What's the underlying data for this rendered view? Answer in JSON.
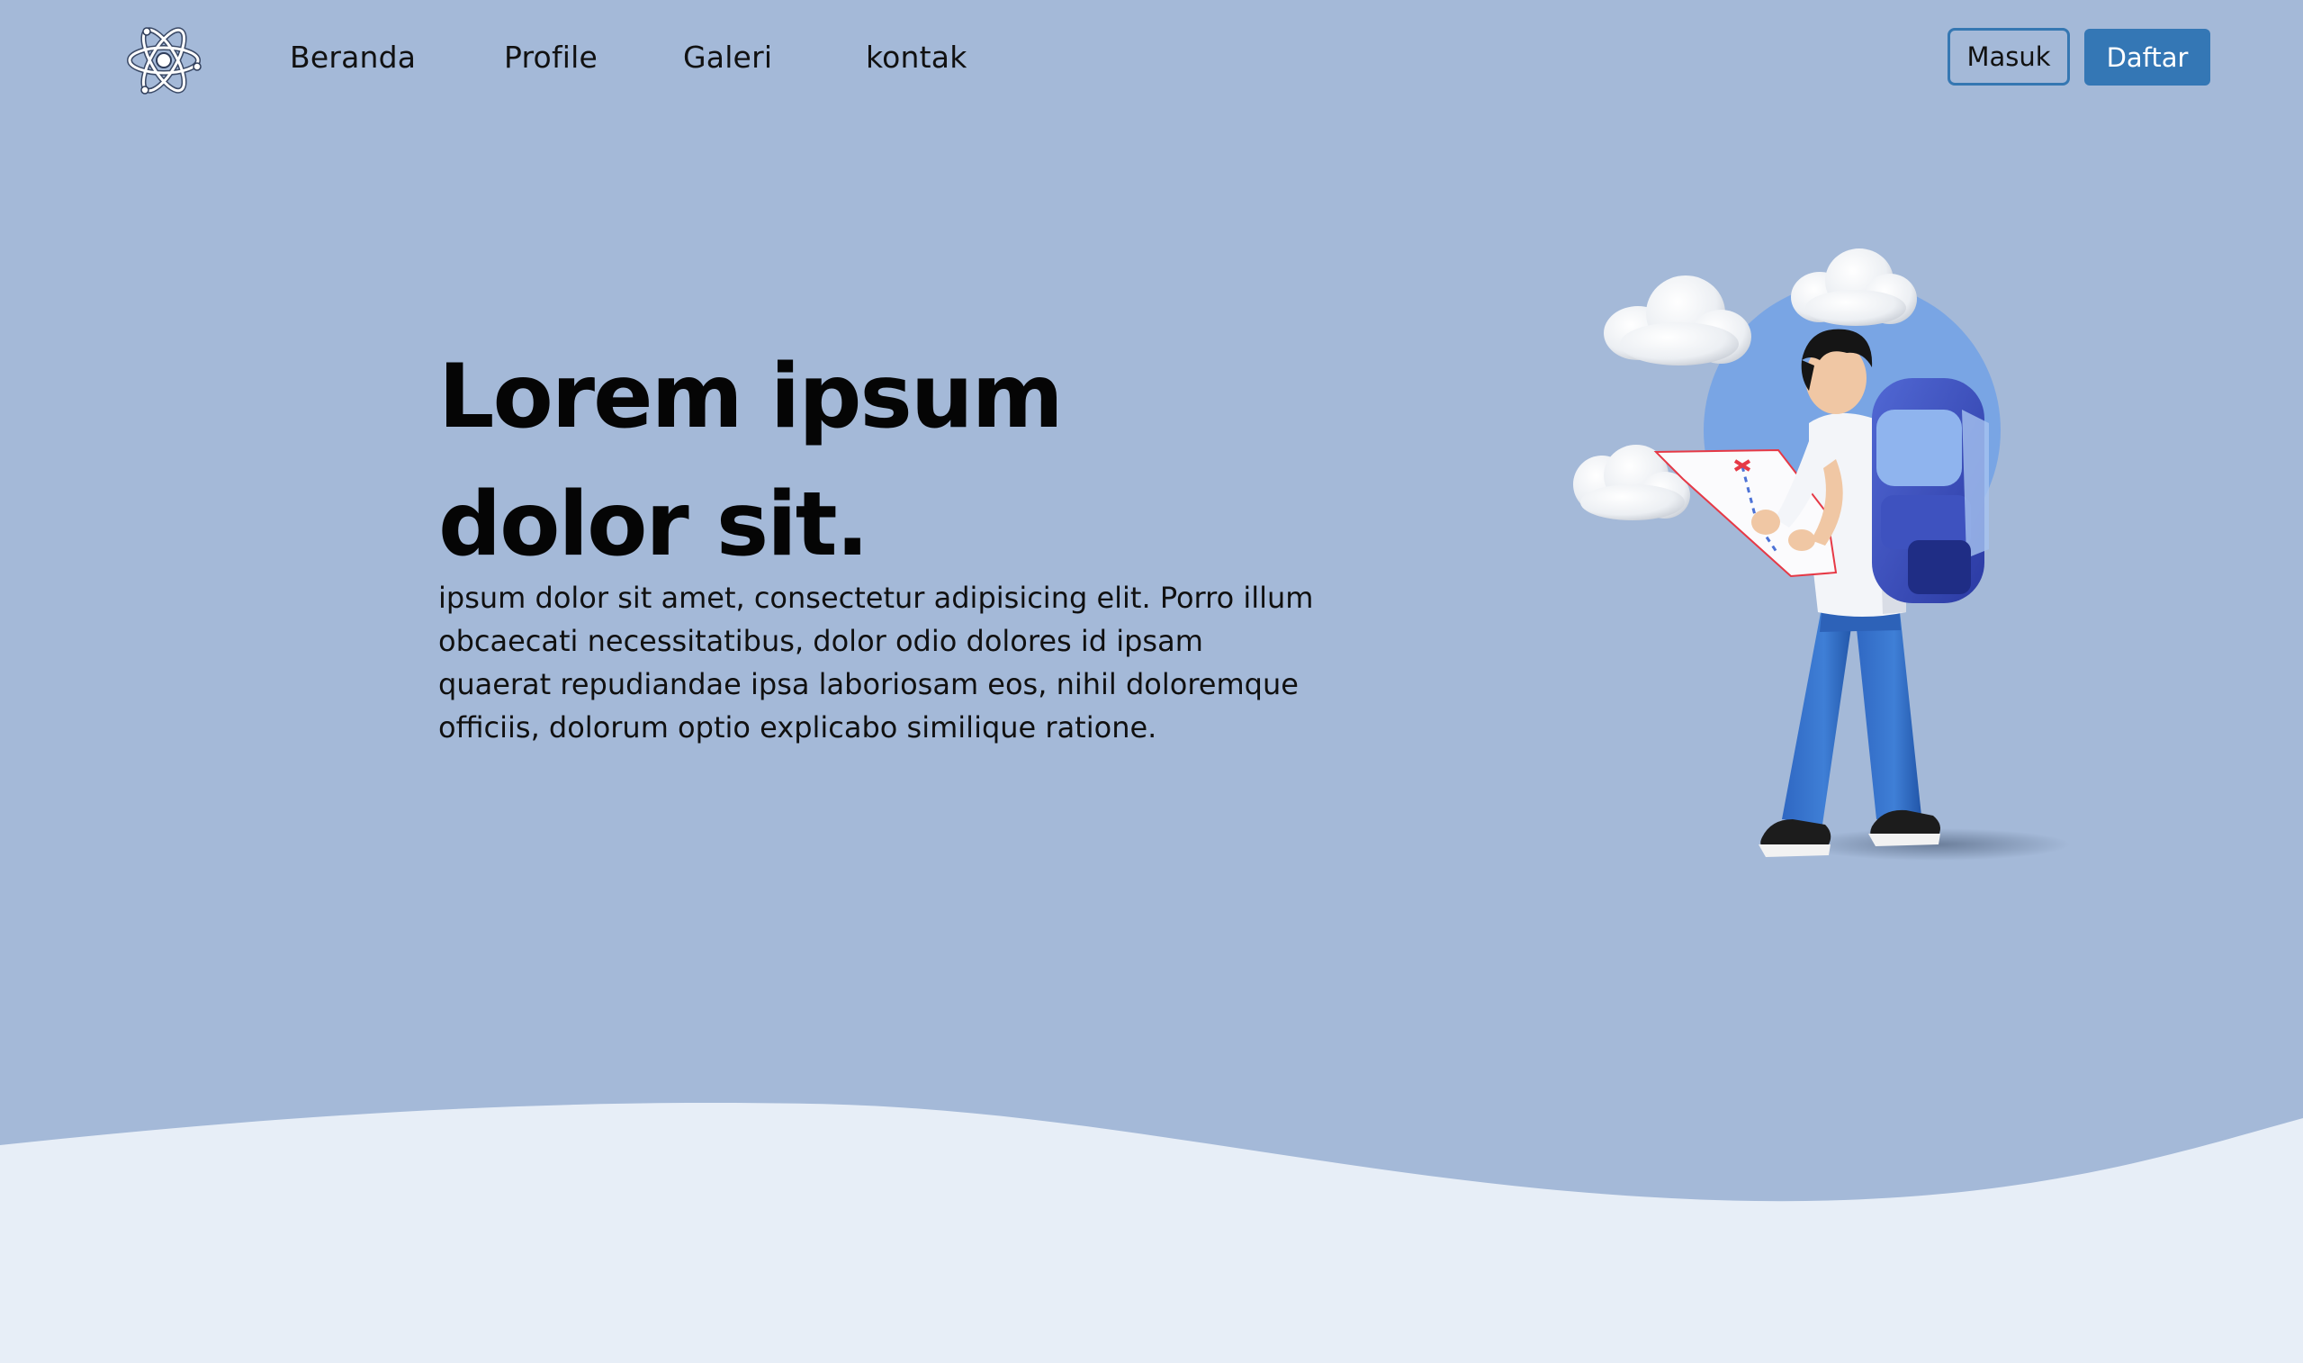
{
  "navbar": {
    "logo_icon": "atom-icon",
    "links": [
      "Beranda",
      "Profile",
      "Galeri",
      "kontak"
    ],
    "login_label": "Masuk",
    "register_label": "Daftar"
  },
  "hero": {
    "title": "Lorem ipsum dolor sit.",
    "text": "ipsum dolor sit amet, consectetur adipisicing elit. Porro illum obcaecati necessitatibus, dolor odio dolores id ipsam quaerat repudiandae ipsa laboriosam eos, nihil doloremque officiis, dolorum optio explicabo similique ratione.",
    "illustration": "backpacker-reading-map-illustration"
  },
  "colors": {
    "background": "#a4b9d8",
    "wave": "#e7eef7",
    "accent": "#3477b5"
  }
}
